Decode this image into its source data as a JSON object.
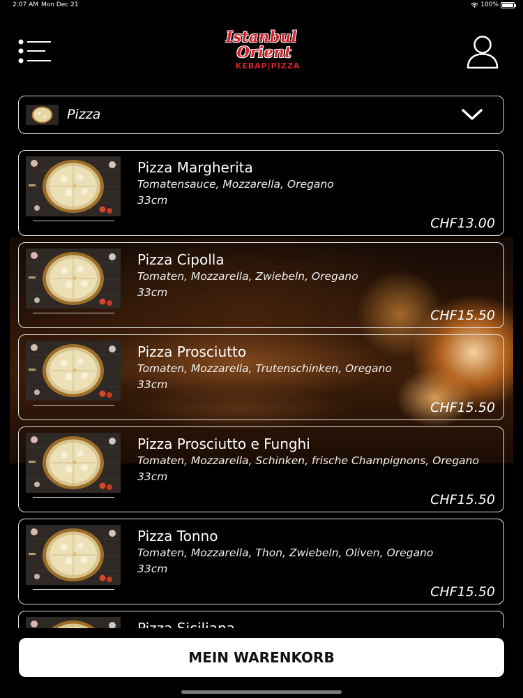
{
  "status_bar": {
    "time": "2:07 AM",
    "date": "Mon Dec 21",
    "battery": "100%"
  },
  "header": {
    "logo_line1": "Istanbul",
    "logo_line2": "Orient",
    "logo_sub": "KEBAP|PIZZA",
    "accent_color": "#d6222a"
  },
  "category": {
    "selected": "Pizza",
    "icon": "chevron-down-icon"
  },
  "items": [
    {
      "name": "Pizza Margherita",
      "desc": "Tomatensauce, Mozzarella, Oregano",
      "size": "33cm",
      "price": "CHF13.00"
    },
    {
      "name": "Pizza Cipolla",
      "desc": "Tomaten, Mozzarella, Zwiebeln, Oregano",
      "size": "33cm",
      "price": "CHF15.50"
    },
    {
      "name": "Pizza Prosciutto",
      "desc": "Tomaten, Mozzarella, Trutenschinken, Oregano",
      "size": "33cm",
      "price": "CHF15.50"
    },
    {
      "name": "Pizza Prosciutto e Funghi",
      "desc": "Tomaten, Mozzarella, Schinken, frische Champignons, Oregano",
      "size": "33cm",
      "price": "CHF15.50"
    },
    {
      "name": "Pizza Tonno",
      "desc": "Tomaten, Mozzarella, Thon, Zwiebeln, Oliven, Oregano",
      "size": "33cm",
      "price": "CHF15.50"
    },
    {
      "name": "Pizza Siciliana",
      "desc": "",
      "size": "",
      "price": ""
    }
  ],
  "cart": {
    "label": "MEIN WARENKORB"
  }
}
